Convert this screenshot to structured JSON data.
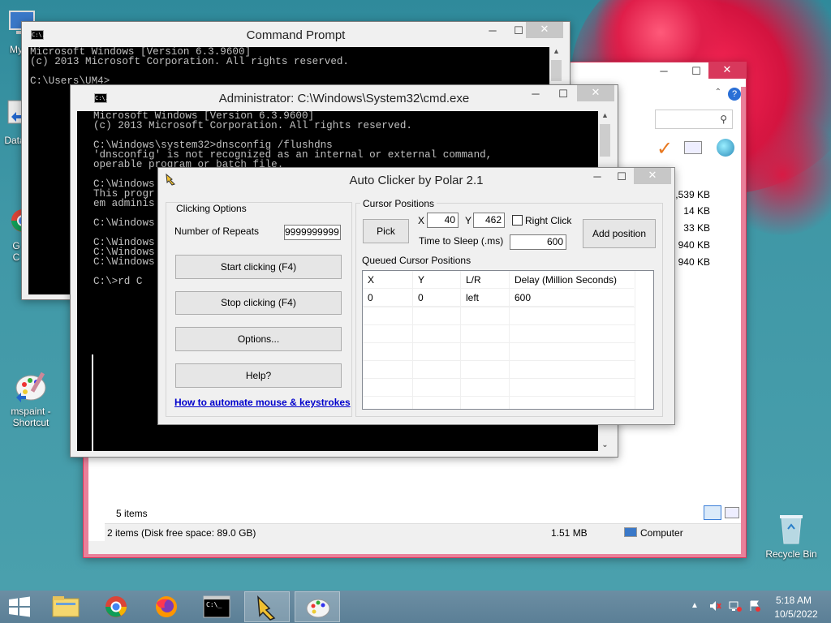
{
  "desktop": {
    "icons": [
      {
        "label": "My C"
      },
      {
        "label": "Data"
      },
      {
        "label": "G\nC"
      },
      {
        "label": "mspaint -\nShortcut"
      },
      {
        "label": "Recycle Bin"
      }
    ]
  },
  "explorer": {
    "file_sizes": [
      "1,539 KB",
      "14 KB",
      "33 KB",
      "940 KB",
      "940 KB"
    ],
    "items_count": "5 items",
    "status_left": "2 items (Disk free space: 89.0 GB)",
    "status_size": "1.51 MB",
    "status_location": "Computer"
  },
  "cmd1": {
    "title": "Command Prompt",
    "icon_text": "C:\\.",
    "lines": "Microsoft Windows [Version 6.3.9600]\n(c) 2013 Microsoft Corporation. All rights reserved.\n\nC:\\Users\\UM4>"
  },
  "cmd2": {
    "title": "Administrator: C:\\Windows\\System32\\cmd.exe",
    "icon_text": "C:\\.",
    "lines": "Microsoft Windows [Version 6.3.9600]\n(c) 2013 Microsoft Corporation. All rights reserved.\n\nC:\\Windows\\system32>dnsconfig /flushdns\n'dnsconfig' is not recognized as an internal or external command,\noperable program or batch file.\n\nC:\\Windows\nThis progr\nem adminis\n\nC:\\Windows\n\nC:\\Windows\nC:\\Windows\nC:\\Windows\n\nC:\\>rd C"
  },
  "autoclicker": {
    "title": "Auto Clicker by Polar 2.1",
    "clicking_options": {
      "group_label": "Clicking Options",
      "repeats_label": "Number of Repeats",
      "repeats_value": "9999999999",
      "start_label": "Start clicking (F4)",
      "stop_label": "Stop clicking (F4)",
      "options_label": "Options...",
      "help_label": "Help?",
      "link_label": "How to automate mouse & keystrokes"
    },
    "cursor_positions": {
      "group_label": "Cursor Positions",
      "pick_label": "Pick",
      "x_label": "X",
      "x_value": "40",
      "y_label": "Y",
      "y_value": "462",
      "right_click_label": "Right Click",
      "sleep_label": "Time to Sleep (.ms)",
      "sleep_value": "600",
      "add_label": "Add position",
      "queued_label": "Queued Cursor Positions",
      "columns": [
        "X",
        "Y",
        "L/R",
        "Delay (Million Seconds)"
      ],
      "rows": [
        {
          "x": "0",
          "y": "0",
          "lr": "left",
          "delay": "600"
        }
      ]
    }
  },
  "taskbar": {
    "time": "5:18 AM",
    "date": "10/5/2022"
  },
  "colors": {
    "link": "#0000cc",
    "close_button": "#c7c7c7",
    "taskbar": "#5b7f96"
  }
}
